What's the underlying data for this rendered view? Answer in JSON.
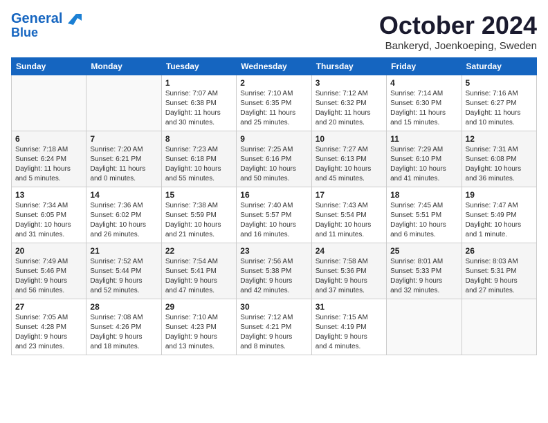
{
  "logo": {
    "line1": "General",
    "line2": "Blue"
  },
  "title": "October 2024",
  "location": "Bankeryd, Joenkoeping, Sweden",
  "days_of_week": [
    "Sunday",
    "Monday",
    "Tuesday",
    "Wednesday",
    "Thursday",
    "Friday",
    "Saturday"
  ],
  "weeks": [
    [
      {
        "num": "",
        "info": ""
      },
      {
        "num": "",
        "info": ""
      },
      {
        "num": "1",
        "info": "Sunrise: 7:07 AM\nSunset: 6:38 PM\nDaylight: 11 hours\nand 30 minutes."
      },
      {
        "num": "2",
        "info": "Sunrise: 7:10 AM\nSunset: 6:35 PM\nDaylight: 11 hours\nand 25 minutes."
      },
      {
        "num": "3",
        "info": "Sunrise: 7:12 AM\nSunset: 6:32 PM\nDaylight: 11 hours\nand 20 minutes."
      },
      {
        "num": "4",
        "info": "Sunrise: 7:14 AM\nSunset: 6:30 PM\nDaylight: 11 hours\nand 15 minutes."
      },
      {
        "num": "5",
        "info": "Sunrise: 7:16 AM\nSunset: 6:27 PM\nDaylight: 11 hours\nand 10 minutes."
      }
    ],
    [
      {
        "num": "6",
        "info": "Sunrise: 7:18 AM\nSunset: 6:24 PM\nDaylight: 11 hours\nand 5 minutes."
      },
      {
        "num": "7",
        "info": "Sunrise: 7:20 AM\nSunset: 6:21 PM\nDaylight: 11 hours\nand 0 minutes."
      },
      {
        "num": "8",
        "info": "Sunrise: 7:23 AM\nSunset: 6:18 PM\nDaylight: 10 hours\nand 55 minutes."
      },
      {
        "num": "9",
        "info": "Sunrise: 7:25 AM\nSunset: 6:16 PM\nDaylight: 10 hours\nand 50 minutes."
      },
      {
        "num": "10",
        "info": "Sunrise: 7:27 AM\nSunset: 6:13 PM\nDaylight: 10 hours\nand 45 minutes."
      },
      {
        "num": "11",
        "info": "Sunrise: 7:29 AM\nSunset: 6:10 PM\nDaylight: 10 hours\nand 41 minutes."
      },
      {
        "num": "12",
        "info": "Sunrise: 7:31 AM\nSunset: 6:08 PM\nDaylight: 10 hours\nand 36 minutes."
      }
    ],
    [
      {
        "num": "13",
        "info": "Sunrise: 7:34 AM\nSunset: 6:05 PM\nDaylight: 10 hours\nand 31 minutes."
      },
      {
        "num": "14",
        "info": "Sunrise: 7:36 AM\nSunset: 6:02 PM\nDaylight: 10 hours\nand 26 minutes."
      },
      {
        "num": "15",
        "info": "Sunrise: 7:38 AM\nSunset: 5:59 PM\nDaylight: 10 hours\nand 21 minutes."
      },
      {
        "num": "16",
        "info": "Sunrise: 7:40 AM\nSunset: 5:57 PM\nDaylight: 10 hours\nand 16 minutes."
      },
      {
        "num": "17",
        "info": "Sunrise: 7:43 AM\nSunset: 5:54 PM\nDaylight: 10 hours\nand 11 minutes."
      },
      {
        "num": "18",
        "info": "Sunrise: 7:45 AM\nSunset: 5:51 PM\nDaylight: 10 hours\nand 6 minutes."
      },
      {
        "num": "19",
        "info": "Sunrise: 7:47 AM\nSunset: 5:49 PM\nDaylight: 10 hours\nand 1 minute."
      }
    ],
    [
      {
        "num": "20",
        "info": "Sunrise: 7:49 AM\nSunset: 5:46 PM\nDaylight: 9 hours\nand 56 minutes."
      },
      {
        "num": "21",
        "info": "Sunrise: 7:52 AM\nSunset: 5:44 PM\nDaylight: 9 hours\nand 52 minutes."
      },
      {
        "num": "22",
        "info": "Sunrise: 7:54 AM\nSunset: 5:41 PM\nDaylight: 9 hours\nand 47 minutes."
      },
      {
        "num": "23",
        "info": "Sunrise: 7:56 AM\nSunset: 5:38 PM\nDaylight: 9 hours\nand 42 minutes."
      },
      {
        "num": "24",
        "info": "Sunrise: 7:58 AM\nSunset: 5:36 PM\nDaylight: 9 hours\nand 37 minutes."
      },
      {
        "num": "25",
        "info": "Sunrise: 8:01 AM\nSunset: 5:33 PM\nDaylight: 9 hours\nand 32 minutes."
      },
      {
        "num": "26",
        "info": "Sunrise: 8:03 AM\nSunset: 5:31 PM\nDaylight: 9 hours\nand 27 minutes."
      }
    ],
    [
      {
        "num": "27",
        "info": "Sunrise: 7:05 AM\nSunset: 4:28 PM\nDaylight: 9 hours\nand 23 minutes."
      },
      {
        "num": "28",
        "info": "Sunrise: 7:08 AM\nSunset: 4:26 PM\nDaylight: 9 hours\nand 18 minutes."
      },
      {
        "num": "29",
        "info": "Sunrise: 7:10 AM\nSunset: 4:23 PM\nDaylight: 9 hours\nand 13 minutes."
      },
      {
        "num": "30",
        "info": "Sunrise: 7:12 AM\nSunset: 4:21 PM\nDaylight: 9 hours\nand 8 minutes."
      },
      {
        "num": "31",
        "info": "Sunrise: 7:15 AM\nSunset: 4:19 PM\nDaylight: 9 hours\nand 4 minutes."
      },
      {
        "num": "",
        "info": ""
      },
      {
        "num": "",
        "info": ""
      }
    ]
  ]
}
